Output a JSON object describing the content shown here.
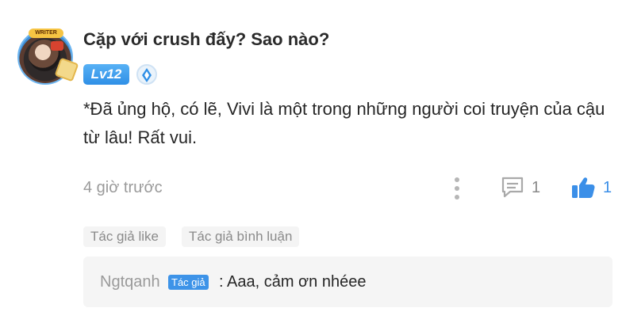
{
  "comment": {
    "title": "Cặp với crush đấy? Sao nào?",
    "level": "Lv12",
    "body": "*Đã ủng hộ, có lẽ, Vivi là một trong những người coi truyện của cậu từ lâu! Rất vui.",
    "time": "4 giờ trước",
    "reply_count": "1",
    "like_count": "1",
    "avatar_badge_text": "WRITER"
  },
  "tags": [
    "Tác giả like",
    "Tác giả bình luận"
  ],
  "reply": {
    "name": "Ngtqanh",
    "badge": "Tác giả",
    "text": ": Aaa, cảm ơn nhéee"
  },
  "colors": {
    "accent": "#3b8fe8",
    "muted": "#9a9a9a",
    "reply_bg": "#f5f5f5"
  },
  "icons": [
    "more-vertical-icon",
    "comment-icon",
    "thumbs-up-icon",
    "rank-icon"
  ]
}
